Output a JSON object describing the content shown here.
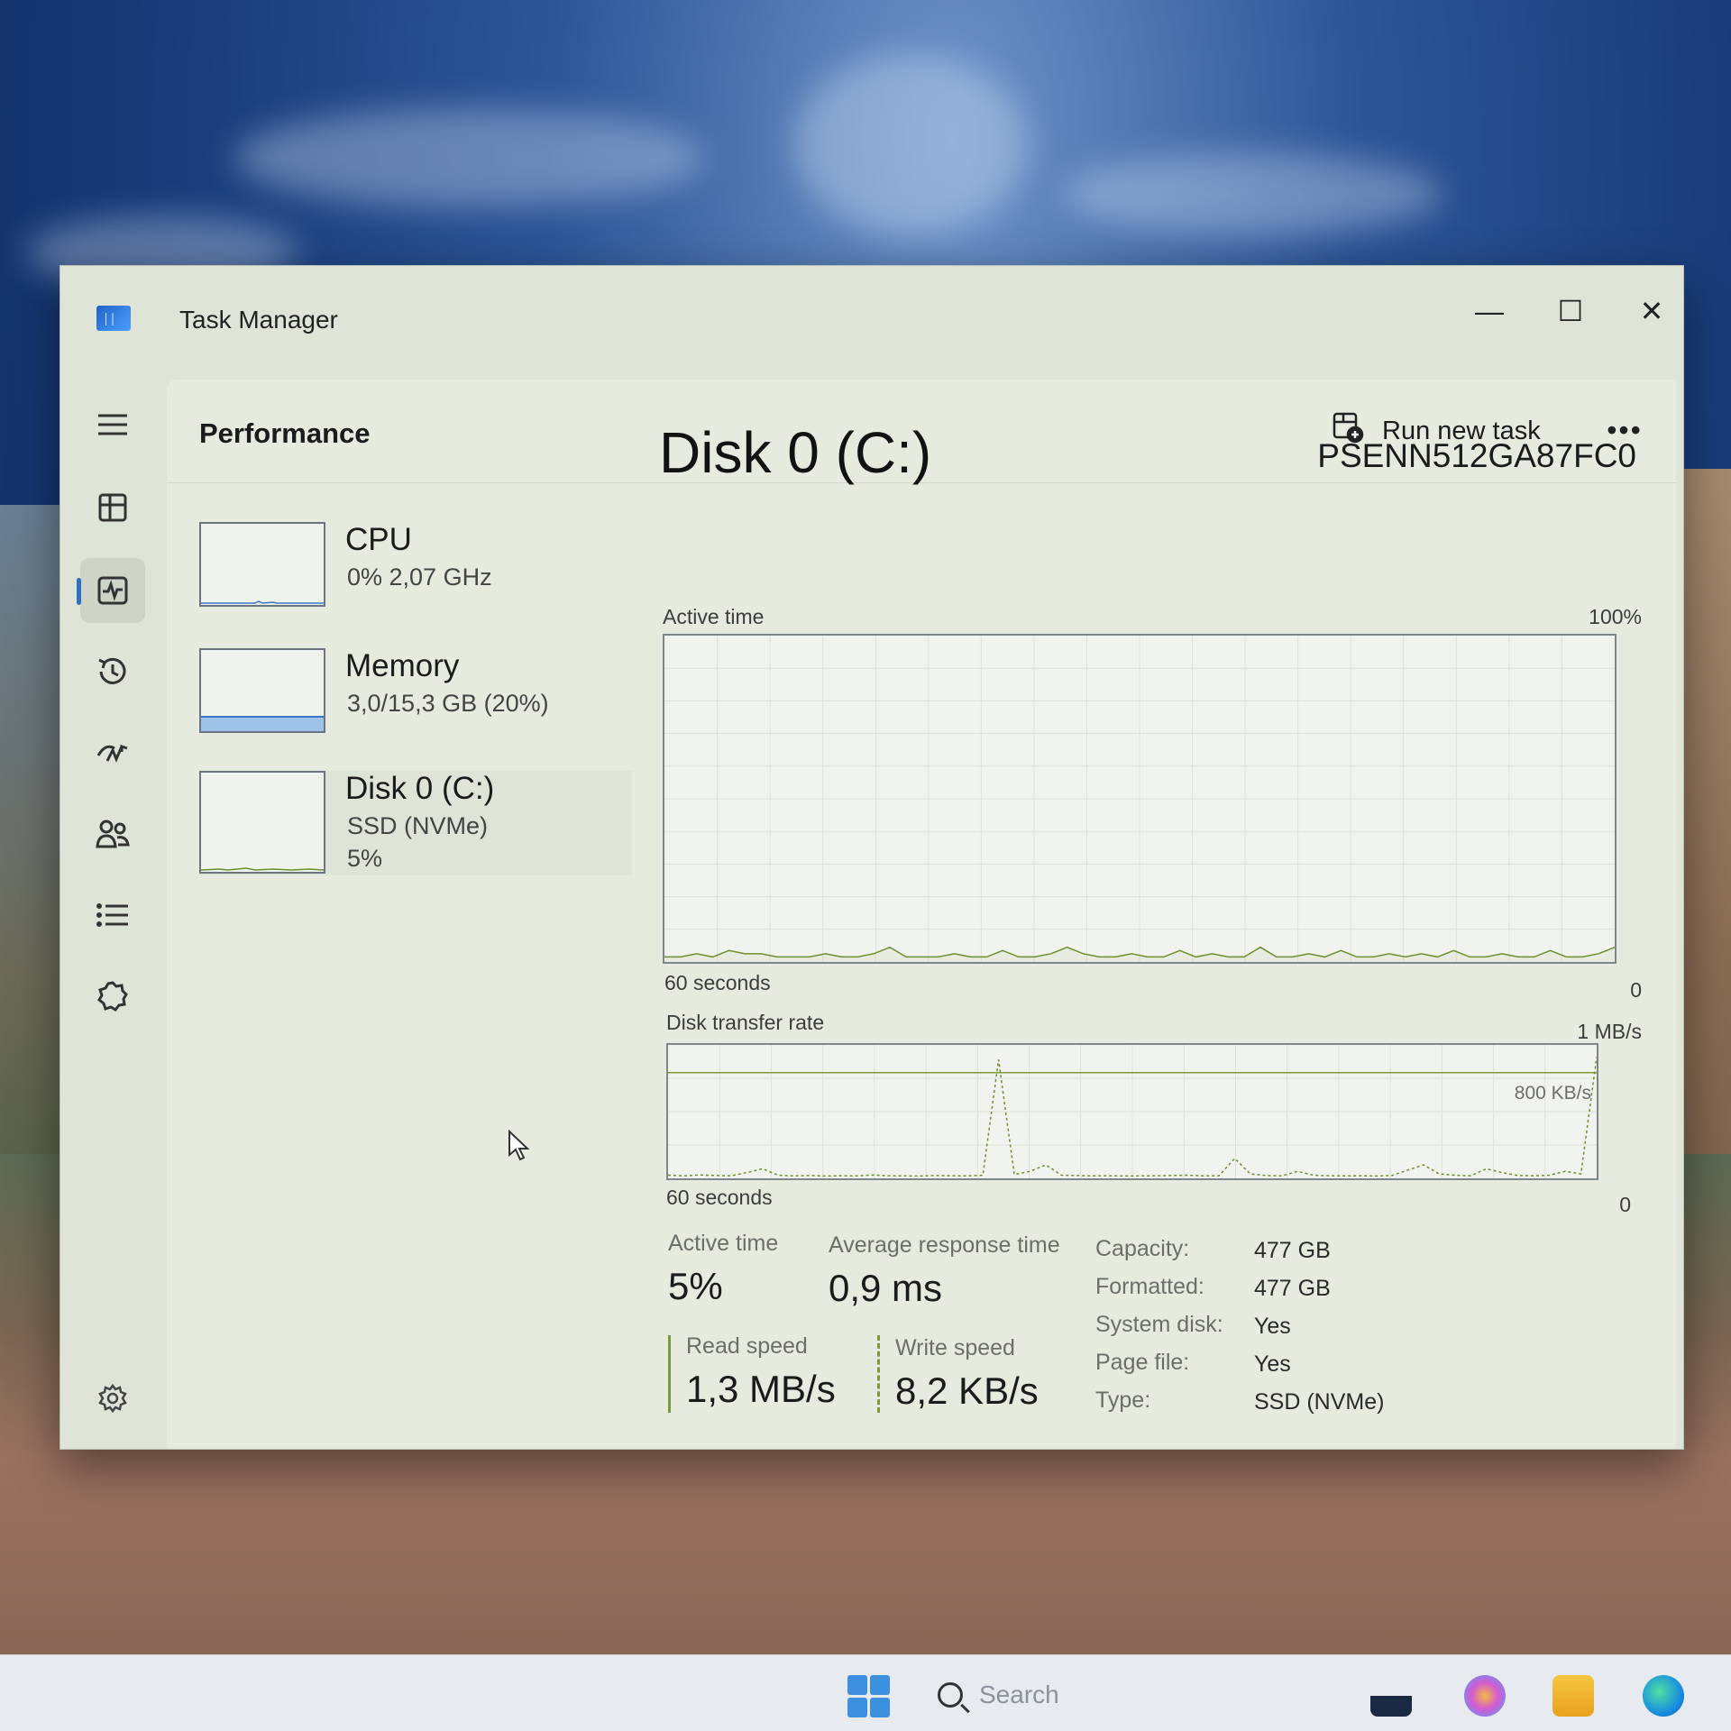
{
  "window": {
    "title": "Task Manager",
    "minimize": "—",
    "maximize": "☐",
    "close": "✕"
  },
  "header": {
    "title": "Performance",
    "run_task": "Run new task",
    "more": "•••"
  },
  "devices": [
    {
      "name": "CPU",
      "sub": "0%  2,07 GHz",
      "sub2": ""
    },
    {
      "name": "Memory",
      "sub": "3,0/15,3 GB (20%)",
      "sub2": ""
    },
    {
      "name": "Disk 0 (C:)",
      "sub": "SSD (NVMe)",
      "sub2": "5%"
    }
  ],
  "detail": {
    "title": "Disk 0 (C:)",
    "model": "PSENN512GA87FC0"
  },
  "graph1": {
    "label": "Active time",
    "max": "100%",
    "span": "60 seconds",
    "min": "0"
  },
  "graph2": {
    "label": "Disk transfer rate",
    "max": "1 MB/s",
    "ref": "800 KB/s",
    "span": "60 seconds",
    "min": "0"
  },
  "stats": {
    "active_time_label": "Active time",
    "active_time_value": "5%",
    "avg_resp_label": "Average response time",
    "avg_resp_value": "0,9 ms",
    "read_label": "Read speed",
    "read_value": "1,3 MB/s",
    "write_label": "Write speed",
    "write_value": "8,2 KB/s"
  },
  "properties": [
    {
      "key": "Capacity:",
      "value": "477 GB"
    },
    {
      "key": "Formatted:",
      "value": "477 GB"
    },
    {
      "key": "System disk:",
      "value": "Yes"
    },
    {
      "key": "Page file:",
      "value": "Yes"
    },
    {
      "key": "Type:",
      "value": "SSD (NVMe)"
    }
  ],
  "taskbar": {
    "search_placeholder": "Search"
  },
  "chart_data": [
    {
      "type": "line",
      "title": "Active time",
      "ylim": [
        0,
        100
      ],
      "y_unit": "%",
      "x_span_seconds": 60,
      "series": [
        {
          "values": [
            1,
            1,
            2,
            1,
            3,
            2,
            2,
            1,
            1,
            1,
            2,
            1,
            1,
            2,
            4,
            1,
            1,
            1,
            2,
            1,
            1,
            3,
            1,
            1,
            2,
            4,
            2,
            1,
            1,
            2,
            1,
            1,
            3,
            1,
            2,
            1,
            1,
            4,
            1,
            1,
            2,
            1,
            3,
            1,
            1,
            2,
            1,
            2,
            1,
            3,
            1,
            1,
            2,
            1,
            1,
            3,
            1,
            1,
            2,
            4
          ]
        }
      ]
    },
    {
      "type": "line",
      "title": "Disk transfer rate",
      "ylim": [
        0,
        1000
      ],
      "y_unit": "KB/s",
      "x_span_seconds": 60,
      "reference_line": 800,
      "series": [
        {
          "values": [
            10,
            5,
            12,
            8,
            6,
            30,
            60,
            10,
            5,
            8,
            4,
            6,
            5,
            12,
            6,
            5,
            4,
            8,
            6,
            5,
            10,
            900,
            15,
            40,
            90,
            10,
            8,
            5,
            6,
            4,
            5,
            6,
            8,
            10,
            5,
            6,
            140,
            20,
            8,
            5,
            40,
            10,
            6,
            5,
            6,
            4,
            8,
            50,
            90,
            20,
            10,
            6,
            60,
            30,
            8,
            6,
            10,
            40,
            20,
            920
          ]
        }
      ]
    }
  ]
}
